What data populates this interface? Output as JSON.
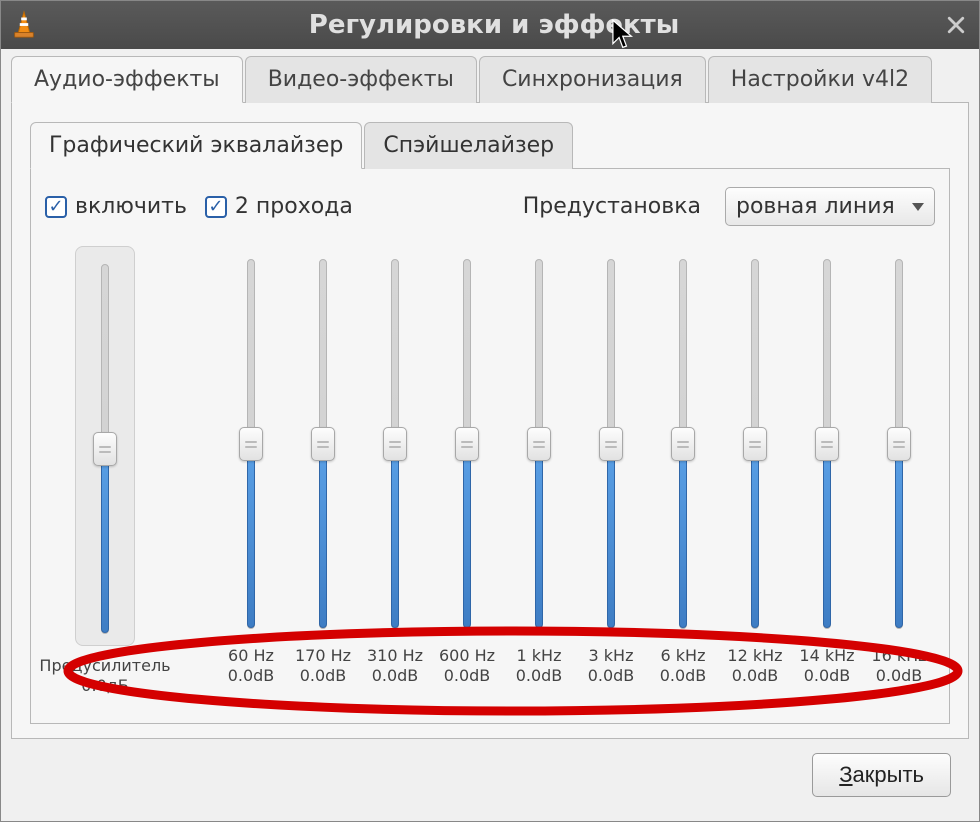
{
  "window": {
    "title": "Регулировки и эффекты"
  },
  "tabs": {
    "audio": "Аудио-эффекты",
    "video": "Видео-эффекты",
    "sync": "Синхронизация",
    "v4l2": "Настройки v4l2"
  },
  "subtabs": {
    "eq": "Графический эквалайзер",
    "spatial": "Спэйшелайзер"
  },
  "eq": {
    "enable_label": "включить",
    "twopass_label": "2 прохода",
    "preset_label": "Предустановка",
    "preset_value": "ровная линия",
    "preamp": {
      "label": "Предусилитель",
      "value_text": "0.0дБ",
      "fill_percent": 50
    },
    "bands": [
      {
        "freq": "60 Hz",
        "value_text": "0.0dB",
        "fill_percent": 50
      },
      {
        "freq": "170 Hz",
        "value_text": "0.0dB",
        "fill_percent": 50
      },
      {
        "freq": "310 Hz",
        "value_text": "0.0dB",
        "fill_percent": 50
      },
      {
        "freq": "600 Hz",
        "value_text": "0.0dB",
        "fill_percent": 50
      },
      {
        "freq": "1 kHz",
        "value_text": "0.0dB",
        "fill_percent": 50
      },
      {
        "freq": "3 kHz",
        "value_text": "0.0dB",
        "fill_percent": 50
      },
      {
        "freq": "6 kHz",
        "value_text": "0.0dB",
        "fill_percent": 50
      },
      {
        "freq": "12 kHz",
        "value_text": "0.0dB",
        "fill_percent": 50
      },
      {
        "freq": "14 kHz",
        "value_text": "0.0dB",
        "fill_percent": 50
      },
      {
        "freq": "16 kHz",
        "value_text": "0.0dB",
        "fill_percent": 50
      }
    ]
  },
  "footer": {
    "close_prefix": "З",
    "close_rest": "акрыть"
  }
}
